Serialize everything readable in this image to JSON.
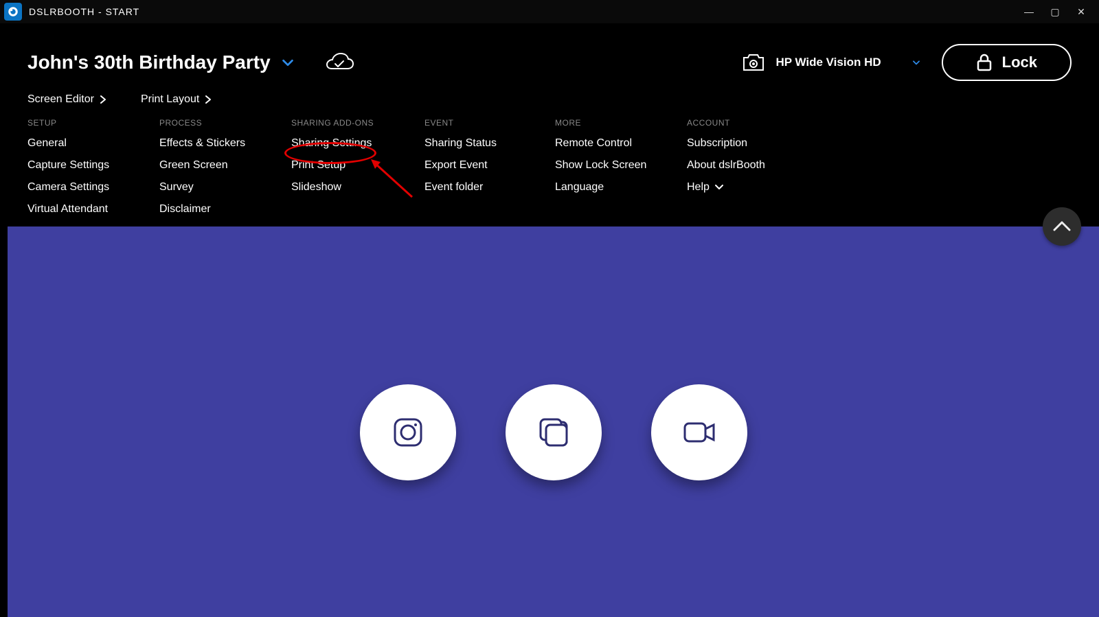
{
  "window": {
    "title": "DSLRBOOTH - START"
  },
  "header": {
    "event_name": "John's 30th Birthday Party",
    "screen_editor_label": "Screen Editor",
    "print_layout_label": "Print Layout",
    "camera_label": "HP Wide Vision HD",
    "lock_label": "Lock"
  },
  "menu": {
    "setup": {
      "heading": "SETUP",
      "items": [
        "General",
        "Capture Settings",
        "Camera Settings",
        "Virtual Attendant"
      ]
    },
    "process": {
      "heading": "PROCESS",
      "items": [
        "Effects & Stickers",
        "Green Screen",
        "Survey",
        "Disclaimer"
      ]
    },
    "sharing": {
      "heading": "SHARING ADD-ONS",
      "items": [
        "Sharing Settings",
        "Print Setup",
        "Slideshow"
      ]
    },
    "event": {
      "heading": "EVENT",
      "items": [
        "Sharing Status",
        "Export Event",
        "Event folder"
      ]
    },
    "more": {
      "heading": "MORE",
      "items": [
        "Remote Control",
        "Show Lock Screen",
        "Language"
      ]
    },
    "account": {
      "heading": "ACCOUNT",
      "items": [
        "Subscription",
        "About dslrBooth",
        "Help"
      ]
    }
  },
  "stage": {
    "action_icons": [
      "camera-icon",
      "stack-icon",
      "video-icon"
    ]
  }
}
